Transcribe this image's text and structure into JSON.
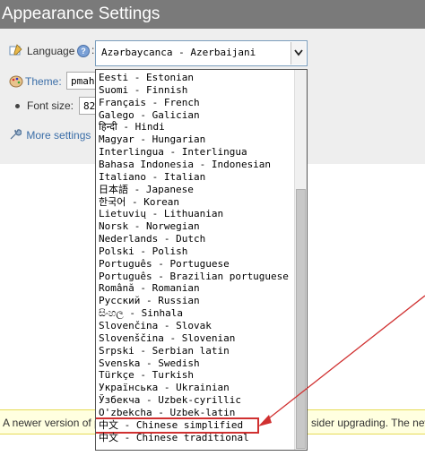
{
  "window": {
    "title": "Appearance Settings"
  },
  "language": {
    "label": "Language",
    "help_glyph": "?",
    "colon": ":",
    "selected": "Azərbaycanca - Azerbaijani",
    "options": [
      "Eesti - Estonian",
      "Suomi - Finnish",
      "Français - French",
      "Galego - Galician",
      "हिन्दी - Hindi",
      "Magyar - Hungarian",
      "Interlingua - Interlingua",
      "Bahasa Indonesia - Indonesian",
      "Italiano - Italian",
      "日本語 - Japanese",
      "한국어 - Korean",
      "Lietuvių - Lithuanian",
      "Norsk - Norwegian",
      "Nederlands - Dutch",
      "Polski - Polish",
      "Português - Portuguese",
      "Português - Brazilian portuguese",
      "Română - Romanian",
      "Русский - Russian",
      "සිංහල - Sinhala",
      "Slovenčina - Slovak",
      "Slovenščina - Slovenian",
      "Srpski - Serbian latin",
      "Svenska - Swedish",
      "Türkçe - Turkish",
      "Українська - Ukrainian",
      "Ўзбекча - Uzbek-cyrillic",
      "O'zbekcha - Uzbek-latin",
      "中文 - Chinese simplified",
      "中文 - Chinese traditional"
    ],
    "highlighted": "中文 - Chinese simplified"
  },
  "theme": {
    "label": "Theme:",
    "value": "pmah"
  },
  "font_size": {
    "label": "Font size:",
    "value": "82"
  },
  "more_settings": {
    "label": "More settings"
  },
  "notice": {
    "left_text": "A newer version of p",
    "right_text": "sider upgrading. The new"
  },
  "colors": {
    "titlebar": "#7a7a7a",
    "panel": "#eeeeee",
    "link": "#3b6ea8",
    "highlight_box": "#d03030",
    "arrow": "#d03030",
    "notice_bg": "#ffffe0"
  },
  "icons": {
    "language": "globe-pencil-icon",
    "theme": "palette-icon",
    "more": "wrench-icon",
    "dropdown": "chevron-down-icon"
  }
}
